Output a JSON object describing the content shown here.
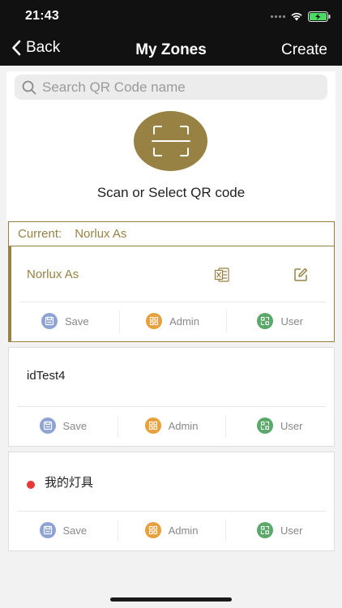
{
  "status_bar": {
    "time": "21:43"
  },
  "nav": {
    "back_label": "Back",
    "title": "My Zones",
    "create_label": "Create"
  },
  "search": {
    "placeholder": "Search QR Code name"
  },
  "scan": {
    "label": "Scan or Select QR code"
  },
  "current": {
    "prefix": "Current:",
    "name": "Norlux As"
  },
  "zones": [
    {
      "name": "Norlux As",
      "active": true,
      "save_label": "Save",
      "admin_label": "Admin",
      "user_label": "User"
    },
    {
      "name": "idTest4",
      "active": false,
      "save_label": "Save",
      "admin_label": "Admin",
      "user_label": "User"
    },
    {
      "name": "我的灯具",
      "active": false,
      "status": "red-dot",
      "save_label": "Save",
      "admin_label": "Admin",
      "user_label": "User"
    }
  ],
  "colors": {
    "accent": "#978243",
    "topbar": "#111111",
    "save_icon": "#8ea3d4",
    "admin_icon": "#e6a03c",
    "user_icon": "#5aa86a",
    "status_dot": "#e53935",
    "battery": "#4cd964"
  },
  "icons": {
    "search": "search-icon",
    "scan": "qr-scan-icon",
    "excel": "excel-icon",
    "edit": "edit-icon",
    "save": "floppy-disk-icon",
    "admin": "qr-grid-icon",
    "user": "qr-user-icon"
  }
}
